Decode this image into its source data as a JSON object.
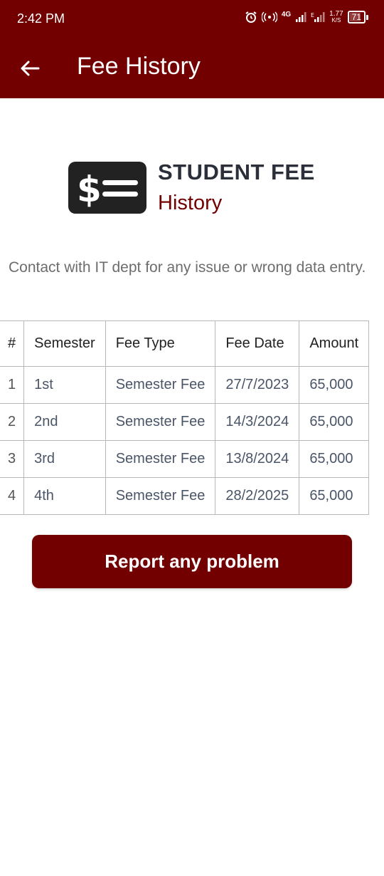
{
  "status_bar": {
    "time": "2:42 PM",
    "network": "4G",
    "speed_value": "1.77",
    "speed_unit": "K/S",
    "battery": "71",
    "icons": [
      "alarm-icon",
      "hotspot-icon",
      "signal-icon",
      "signal-icon",
      "battery-icon"
    ]
  },
  "app_bar": {
    "title": "Fee History",
    "back_icon": "arrow-left-icon",
    "background": "#720000"
  },
  "header": {
    "icon": "dollar-bill-icon",
    "title": "STUDENT FEE",
    "subtitle": "History"
  },
  "notice": "Contact with IT dept for any issue or wrong data entry.",
  "table": {
    "columns": [
      "#",
      "Semester",
      "Fee Type",
      "Fee Date",
      "Amount"
    ],
    "rows": [
      [
        "1",
        "1st",
        "Semester Fee",
        "27/7/2023",
        "65,000"
      ],
      [
        "2",
        "2nd",
        "Semester Fee",
        "14/3/2024",
        "65,000"
      ],
      [
        "3",
        "3rd",
        "Semester Fee",
        "13/8/2024",
        "65,000"
      ],
      [
        "4",
        "4th",
        "Semester Fee",
        "28/2/2025",
        "65,000"
      ]
    ]
  },
  "report_button": "Report any problem",
  "colors": {
    "primary": "#720000",
    "title_text": "#2b2f3a",
    "notice_text": "#6d6d6d"
  }
}
